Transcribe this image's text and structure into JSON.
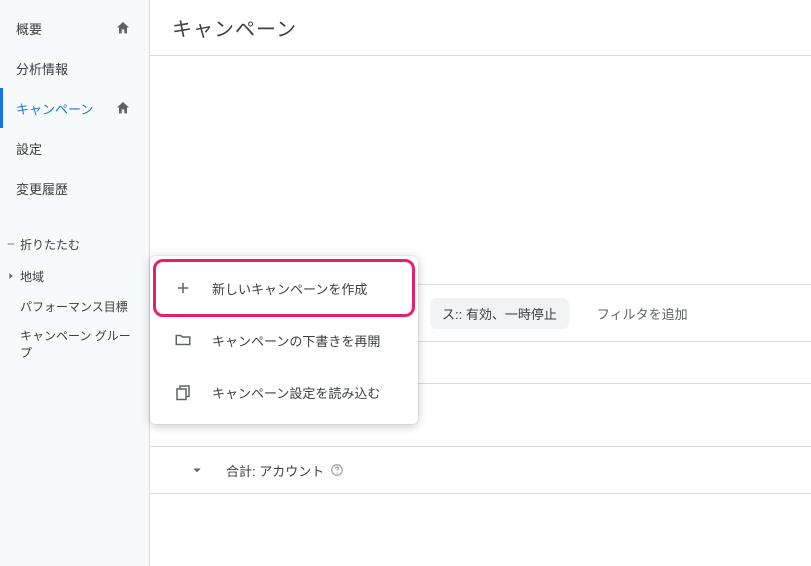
{
  "sidebar": {
    "overview": "概要",
    "insights": "分析情報",
    "campaigns": "キャンペーン",
    "settings": "設定",
    "change_history": "変更履歴",
    "collapse": "折りたたむ",
    "region": "地域",
    "perf_goal": "パフォーマンス目標",
    "campaign_group": "キャンペーン グループ"
  },
  "header": {
    "title": "キャンペーン"
  },
  "toolbar": {
    "status_chip": "ス:: 有効、一時停止",
    "add_filter": "フィルタを追加"
  },
  "totals": {
    "label": "合計: アカウント"
  },
  "popup": {
    "new_campaign": "新しいキャンペーンを作成",
    "resume_draft": "キャンペーンの下書きを再開",
    "load_settings": "キャンペーン設定を読み込む"
  }
}
